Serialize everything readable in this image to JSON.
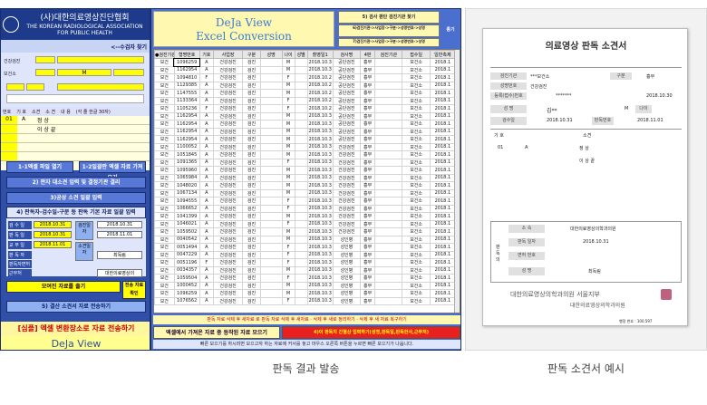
{
  "left_panel": {
    "logo_title": "(사)대한의료영상진단협회",
    "logo_subtitle": "THE KOREAN RADIOLOGICAL ASSOCIATION FOR PUBLIC HEALTH",
    "patient_search": "<--수검자 찾기",
    "field_checkup_name": "건강검진",
    "field_health_center": "보건소",
    "gender_value": "M",
    "list_header": [
      "번호",
      "기 호",
      "소견",
      "소 견",
      "내 용",
      "(각 줄 한글 30자)"
    ],
    "list_rows": [
      {
        "no": "01",
        "code": "A",
        "text": "정 상"
      },
      {
        "no": "",
        "code": "",
        "text": "이 상 끝"
      },
      {
        "no": "",
        "code": "",
        "text": ""
      },
      {
        "no": "",
        "code": "",
        "text": ""
      },
      {
        "no": "",
        "code": "",
        "text": ""
      }
    ],
    "btn_excel_open": "1-1엑셀 파일 열기",
    "btn_import": "1-2일괄판 엑셀 자료 가져오기",
    "btn_auto": "2) 판자 대소견 입력 및 결정기관 결리",
    "btn_confirm": "3)공상 소견 일괄 입력",
    "form_title": "4) 판독자-검수일-구분 등 판독 기본 자료 일괄 입력",
    "form_labels": [
      "검 수 일",
      "판 독 일",
      "교 부 일",
      "판 독 자",
      "판독자면허",
      "근무처"
    ],
    "form_dates": [
      "2018.10.31",
      "2018.10.31",
      "2018.11.01"
    ],
    "form_dates_right": [
      "2018.10.31",
      "2018.11.01",
      "2018.11.01"
    ],
    "form_side": [
      "검진일자",
      "소견일자",
      "판독일자"
    ],
    "doctor_name": "최독림",
    "workplace": "대한의료영상의",
    "btn_save": "모여진 자료를 출기",
    "btn_send": "5) 결산 소견서 자료 전송하기",
    "btn_go": "전송 자료 확인",
    "sample_banner": "[심플] 엑셀 변환장소로 자료 전송하기",
    "brand_footer": "DeJa View"
  },
  "spreadsheet": {
    "title_line1": "DeJa View",
    "title_line2": "Excel Conversion",
    "top_buttons": [
      "5) 검사 판단 검진기관 찾기",
      "6)검진기관->사업장->구분->성명번호->성명",
      "7)검진기관->사업장->구분->성명번호->성명",
      "종기"
    ],
    "columns": [
      "●검진기관",
      "형명번호",
      "기호",
      "사업장",
      "구분",
      "성명",
      "나이",
      "성별",
      "촬영일1",
      "검사명",
      "4판",
      "검진기관",
      "접수일",
      "일반촉제"
    ],
    "rows": [
      [
        "보건",
        "1096259",
        "A",
        "건강검진",
        "검진",
        "",
        "M",
        "",
        "2018.10.3",
        "공단검진",
        "흉부",
        "",
        "보건소",
        "2018.1"
      ],
      [
        "보건",
        "1162954",
        "A",
        "건강검진",
        "검진",
        "",
        "M",
        "",
        "2018.10.3",
        "공단검진",
        "흉부",
        "",
        "보건소",
        "2018.1"
      ],
      [
        "보건",
        "1094810",
        "F",
        "건강검진",
        "검진",
        "",
        "F",
        "",
        "2018.10.2",
        "공단검진",
        "흉부",
        "",
        "보건소",
        "2018.1"
      ],
      [
        "보건",
        "1129385",
        "A",
        "건강검진",
        "검진",
        "",
        "M",
        "",
        "2018.10.2",
        "공단검진",
        "흉부",
        "",
        "보건소",
        "2018.1"
      ],
      [
        "보건",
        "1147555",
        "A",
        "건강검진",
        "검진",
        "",
        "M",
        "",
        "2018.10.2",
        "공단검진",
        "흉부",
        "",
        "보건소",
        "2018.1"
      ],
      [
        "보건",
        "1133364",
        "A",
        "건강검진",
        "검진",
        "",
        "F",
        "",
        "2018.10.2",
        "공단검진",
        "흉부",
        "",
        "보건소",
        "2018.1"
      ],
      [
        "보건",
        "1105236",
        "F",
        "건강검진",
        "검진",
        "",
        "F",
        "",
        "2018.10.2",
        "공단검진",
        "흉부",
        "",
        "보건소",
        "2018.1"
      ],
      [
        "보건",
        "1162954",
        "A",
        "건강검진",
        "검진",
        "",
        "M",
        "",
        "2018.10.3",
        "공단검진",
        "흉부",
        "",
        "보건소",
        "2018.1"
      ],
      [
        "보건",
        "1162954",
        "A",
        "건강검진",
        "검진",
        "",
        "M",
        "",
        "2018.10.3",
        "공단검진",
        "흉부",
        "",
        "보건소",
        "2018.1"
      ],
      [
        "보건",
        "1162954",
        "A",
        "건강검진",
        "검진",
        "",
        "M",
        "",
        "2018.10.3",
        "공단검진",
        "흉부",
        "",
        "보건소",
        "2018.1"
      ],
      [
        "보건",
        "1162954",
        "A",
        "건강검진",
        "검진",
        "",
        "M",
        "",
        "2018.10.3",
        "공단검진",
        "흉부",
        "",
        "보건소",
        "2018.1"
      ],
      [
        "보건",
        "1100052",
        "A",
        "건강검진",
        "검진",
        "",
        "M",
        "",
        "2018.10.3",
        "건강검진",
        "흉부",
        "",
        "보건소",
        "2018.1"
      ],
      [
        "보건",
        "1051845",
        "A",
        "건강검진",
        "검진",
        "",
        "M",
        "",
        "2018.10.3",
        "건강검진",
        "흉부",
        "",
        "보건소",
        "2018.1"
      ],
      [
        "보건",
        "1091365",
        "A",
        "건강검진",
        "검진",
        "",
        "F",
        "",
        "2018.10.3",
        "건강검진",
        "흉부",
        "",
        "보건소",
        "2018.1"
      ],
      [
        "보건",
        "1095960",
        "A",
        "건강검진",
        "검진",
        "",
        "M",
        "",
        "2018.10.3",
        "건강검진",
        "흉부",
        "",
        "보건소",
        "2018.1"
      ],
      [
        "보건",
        "1065984",
        "A",
        "건강검진",
        "검진",
        "",
        "M",
        "",
        "2018.10.3",
        "건강검진",
        "흉부",
        "",
        "보건소",
        "2018.1"
      ],
      [
        "보건",
        "1048020",
        "A",
        "건강검진",
        "검진",
        "",
        "M",
        "",
        "2018.10.3",
        "건강검진",
        "흉부",
        "",
        "보건소",
        "2018.1"
      ],
      [
        "보건",
        "1067134",
        "A",
        "건강검진",
        "검진",
        "",
        "M",
        "",
        "2018.10.3",
        "건강검진",
        "흉부",
        "",
        "보건소",
        "2018.1"
      ],
      [
        "보건",
        "1094555",
        "A",
        "건강검진",
        "검진",
        "",
        "F",
        "",
        "2018.10.3",
        "건강검진",
        "흉부",
        "",
        "보건소",
        "2018.1"
      ],
      [
        "보건",
        "1066652",
        "A",
        "건강검진",
        "검진",
        "",
        "F",
        "",
        "2018.10.3",
        "건강검진",
        "흉부",
        "",
        "보건소",
        "2018.1"
      ],
      [
        "보건",
        "1041399",
        "A",
        "건강검진",
        "검진",
        "",
        "M",
        "",
        "2018.10.3",
        "건강검진",
        "흉부",
        "",
        "보건소",
        "2018.1"
      ],
      [
        "보건",
        "1046021",
        "A",
        "건강검진",
        "검진",
        "",
        "F",
        "",
        "2018.10.3",
        "건강검진",
        "흉부",
        "",
        "보건소",
        "2018.1"
      ],
      [
        "보건",
        "1059502",
        "A",
        "건강검진",
        "검진",
        "",
        "M",
        "",
        "2018.10.3",
        "건강검진",
        "흉부",
        "",
        "보건소",
        "2018.1"
      ],
      [
        "보건",
        "0040542",
        "A",
        "건강검진",
        "검진",
        "",
        "M",
        "",
        "2018.10.3",
        "성인병",
        "흉부",
        "",
        "보건소",
        "2018.1"
      ],
      [
        "보건",
        "0051494",
        "A",
        "건강검진",
        "검진",
        "",
        "F",
        "",
        "2018.10.3",
        "성인병",
        "흉부",
        "",
        "보건소",
        "2018.1"
      ],
      [
        "보건",
        "0047229",
        "A",
        "건강검진",
        "검진",
        "",
        "F",
        "",
        "2018.10.3",
        "성인병",
        "흉부",
        "",
        "보건소",
        "2018.1"
      ],
      [
        "보건",
        "0051196",
        "F",
        "건강검진",
        "검진",
        "",
        "F",
        "",
        "2018.10.3",
        "성인병",
        "흉부",
        "",
        "보건소",
        "2018.1"
      ],
      [
        "보건",
        "0034357",
        "A",
        "건강검진",
        "검진",
        "",
        "M",
        "",
        "2018.10.3",
        "성인병",
        "흉부",
        "",
        "보건소",
        "2018.1"
      ],
      [
        "보건",
        "1059504",
        "A",
        "건강검진",
        "검진",
        "",
        "F",
        "",
        "2018.10.3",
        "성인병",
        "흉부",
        "",
        "보건소",
        "2018.1"
      ],
      [
        "보건",
        "1000452",
        "A",
        "건강검진",
        "검진",
        "",
        "M",
        "",
        "2018.10.3",
        "성인병",
        "흉부",
        "",
        "보건소",
        "2018.1"
      ],
      [
        "보건",
        "1096259",
        "A",
        "건강검진",
        "검진",
        "",
        "M",
        "",
        "2018.10.3",
        "성인병",
        "흉부",
        "",
        "보건소",
        "2018.1"
      ],
      [
        "보건",
        "1076562",
        "A",
        "건강검진",
        "검진",
        "",
        "F",
        "",
        "2018.10.3",
        "성인병",
        "흉부",
        "",
        "보건소",
        "2018.1"
      ]
    ],
    "notice_bar": "판독 자료 삭제 후 새자료 로 판독 자료 삭제 후 새자료 · 삭제 후 새로 정리하기 · 삭제 후 새 자료 복구하기",
    "btn_bottom_left": "엑셀에서 가져온 자료 중 등작된 자료 모으기",
    "btn_bottom_right": "4)이 판독지 간혈상 입력하기(성명,판독일,판독한사,근무처)",
    "status_bar": "빠른 모으기를 하시려면 모으고자 하는 자료에 커서를 놓고 마우스 오른쪽 버튼을 누르면 빠른 모으기가 나옵니다."
  },
  "report": {
    "title": "의료영상 판독 소견서",
    "labels": [
      "검진기관",
      "성명번호",
      "등록(접수)번호",
      "성 명",
      "검수일",
      "판독번호",
      "기 호",
      "소견",
      "판독일자",
      "판독 일자",
      "면허 번호",
      "성 명"
    ],
    "clinic": "***보건소",
    "patient": "김**",
    "gender": "M",
    "age_label": "나이",
    "code_label": "구분",
    "code_value": "흉부",
    "dept": "건강검진",
    "exam_date": "2018.10.30",
    "receipt_date": "2018.10.31",
    "read_date": "2018.11.01",
    "row_code": "01",
    "row_sym": "A",
    "normal1": "정 상",
    "normal2": "이 상 끝",
    "section_org": "소 속",
    "org_value": "대한의료영상의학과의원",
    "read_date_label": "판독 일자",
    "read_date_value": "2018.10.31",
    "license_label": "면허 번호",
    "name_label": "성 명",
    "doctor": "최독림",
    "side_label": "판독의",
    "footer_org": "대한의료영상의학과의원 서울지부",
    "footer_sub": "대한의료영상의학과의원",
    "stamp_note": "행정 번호 : 100.597",
    "ids": "*******",
    "time": "********"
  },
  "captions": {
    "left": "판독 결과 발송",
    "right": "판독 소견서 예시"
  },
  "colors": {
    "panel_blue": "#2f4fa8",
    "highlight_yellow": "#ffff00",
    "alert_red": "#e82020"
  }
}
